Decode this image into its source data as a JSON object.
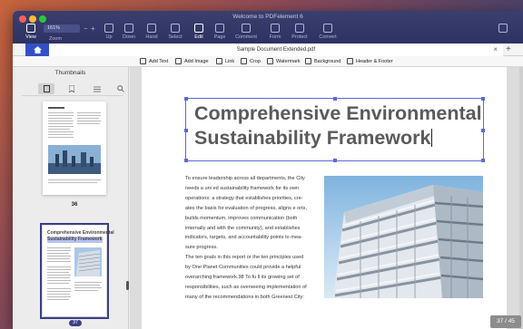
{
  "window": {
    "title": "Welcome to PDFelement 6"
  },
  "toolbar": {
    "zoom_value": "161%",
    "zoom_label": "Zoom",
    "view_label": "View",
    "up_label": "Up",
    "down_label": "Down",
    "hand_label": "Hand",
    "select_label": "Select",
    "edit_label": "Edit",
    "page_label": "Page",
    "comment_label": "Comment",
    "form_label": "Form",
    "protect_label": "Protect",
    "convert_label": "Convert"
  },
  "tabs": {
    "document_name": "Sample Document Extended.pdf"
  },
  "edit_tools": {
    "add_text": "Add Text",
    "add_image": "Add Image",
    "link": "Link",
    "crop": "Crop",
    "watermark": "Watermark",
    "background": "Background",
    "header_footer": "Header & Footer"
  },
  "sidebar": {
    "title": "Thumbnails",
    "pages": [
      {
        "number": "36",
        "selected": false
      },
      {
        "number": "37",
        "selected": true,
        "heading_line1": "Comprehensive Environmental",
        "heading_line2": "Sustainability Framework"
      }
    ]
  },
  "document": {
    "heading_line1": "Comprehensive Environmental",
    "heading_line2": "Sustainability Framework",
    "paragraph1": [
      "To ensure leadership across all departments, the City",
      "needs a uni ed sustainability framework for its own",
      "operations: a strategy that establishes priorities, cre-",
      "ates the basis for evaluation of progress, aligns e orts,",
      "builds momentum, improves communication (both",
      "internally and with the community), and establishes",
      "indicators, targets, and accountability points to mea-",
      "sure progress."
    ],
    "paragraph2": [
      "The ten goals in this report or the ten principles used",
      "by One Planet Communities could provide a helpful",
      "overarching framework.98 To fu ll its growing set of",
      "responsibilities, such as overseeing implementation of",
      "many of the recommendations in both Greenest City:"
    ]
  },
  "status": {
    "page_indicator": "37 / 45"
  },
  "colors": {
    "accent": "#3450c8",
    "selection": "#5b6bd6",
    "titlebar": "#2d3262"
  }
}
